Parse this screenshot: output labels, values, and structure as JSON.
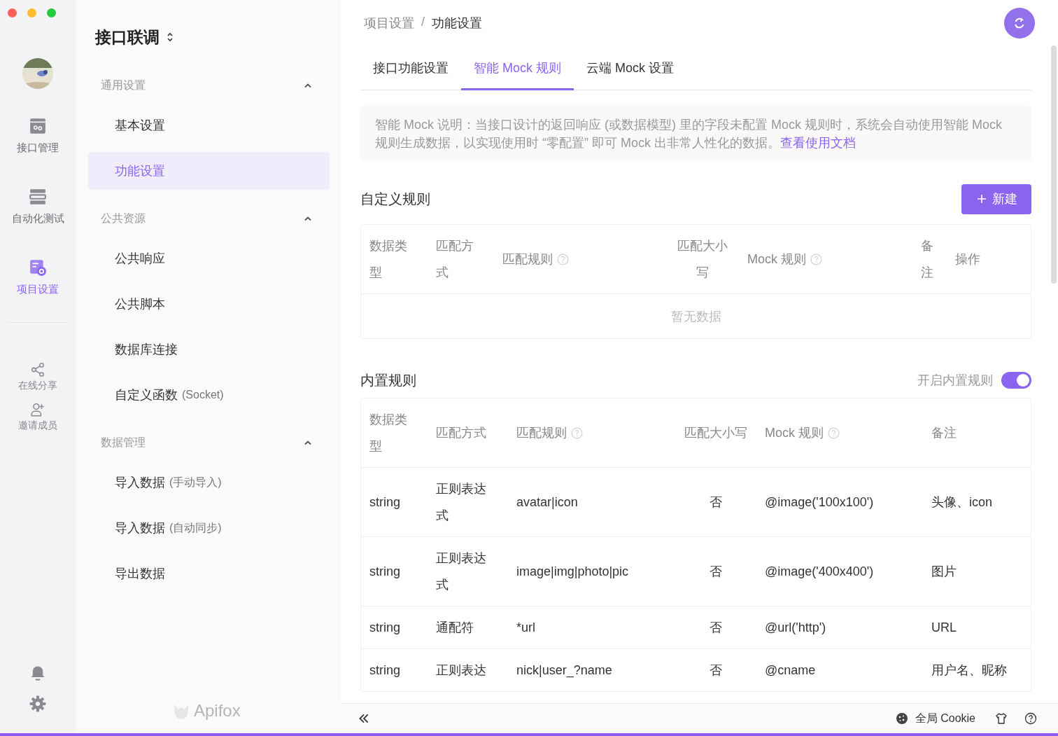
{
  "rail": {
    "main": [
      {
        "label": "接口管理",
        "kind": "api",
        "selected": false
      },
      {
        "label": "自动化测试",
        "kind": "test",
        "selected": false
      },
      {
        "label": "项目设置",
        "kind": "settings",
        "selected": true
      }
    ],
    "secondary": [
      {
        "label": "在线分享",
        "kind": "share"
      },
      {
        "label": "邀请成员",
        "kind": "invite"
      }
    ]
  },
  "sidebar": {
    "title": "接口联调",
    "groups": [
      {
        "title": "通用设置",
        "expanded": true,
        "items": [
          {
            "label": "基本设置",
            "selected": false
          },
          {
            "label": "功能设置",
            "selected": true
          }
        ]
      },
      {
        "title": "公共资源",
        "expanded": true,
        "items": [
          {
            "label": "公共响应",
            "selected": false
          },
          {
            "label": "公共脚本",
            "selected": false
          },
          {
            "label": "数据库连接",
            "selected": false
          },
          {
            "label": "自定义函数",
            "note": "(Socket)",
            "selected": false
          }
        ]
      },
      {
        "title": "数据管理",
        "expanded": true,
        "items": [
          {
            "label": "导入数据",
            "note": "(手动导入)",
            "selected": false
          },
          {
            "label": "导入数据",
            "note": "(自动同步)",
            "selected": false
          },
          {
            "label": "导出数据",
            "selected": false
          }
        ]
      }
    ],
    "brand": "Apifox"
  },
  "breadcrumb": {
    "separator": "/",
    "items": [
      "项目设置",
      "功能设置"
    ]
  },
  "tabs": [
    {
      "label": "接口功能设置",
      "selected": false
    },
    {
      "label": "智能 Mock 规则",
      "selected": true
    },
    {
      "label": "云端 Mock 设置",
      "selected": false
    }
  ],
  "notice": {
    "text": "智能 Mock 说明：当接口设计的返回响应 (或数据模型) 里的字段未配置 Mock 规则时，系统会自动使用智能 Mock 规则生成数据，以实现使用时 “零配置” 即可 Mock 出非常人性化的数据。",
    "link": "查看使用文档"
  },
  "custom_rules": {
    "title": "自定义规则",
    "button": "新建",
    "columns": [
      {
        "label": "数据类型",
        "help": false
      },
      {
        "label": "匹配方式",
        "help": false
      },
      {
        "label": "匹配规则",
        "help": true
      },
      {
        "label": "匹配大小写",
        "help": false
      },
      {
        "label": "Mock 规则",
        "help": true
      },
      {
        "label": "备注",
        "help": false
      },
      {
        "label": "操作",
        "help": false
      }
    ],
    "empty": "暂无数据"
  },
  "builtin_rules": {
    "title": "内置规则",
    "toggle": {
      "label": "开启内置规则",
      "on": true
    },
    "columns": [
      {
        "label": "数据类型",
        "help": false
      },
      {
        "label": "匹配方式",
        "help": false
      },
      {
        "label": "匹配规则",
        "help": true
      },
      {
        "label": "匹配大小写",
        "help": false
      },
      {
        "label": "Mock 规则",
        "help": true
      },
      {
        "label": "备注",
        "help": false
      }
    ],
    "rows": [
      [
        "string",
        "正则表达式",
        "avatar|icon",
        "否",
        "@image('100x100')",
        "头像、icon"
      ],
      [
        "string",
        "正则表达式",
        "image|img|photo|pic",
        "否",
        "@image('400x400')",
        "图片"
      ],
      [
        "string",
        "通配符",
        "*url",
        "否",
        "@url('http')",
        "URL"
      ],
      [
        "string",
        "正则表达",
        "nick|user_?name",
        "否",
        "@cname",
        "用户名、昵称"
      ]
    ]
  },
  "footer": {
    "cookie": "全局 Cookie"
  }
}
